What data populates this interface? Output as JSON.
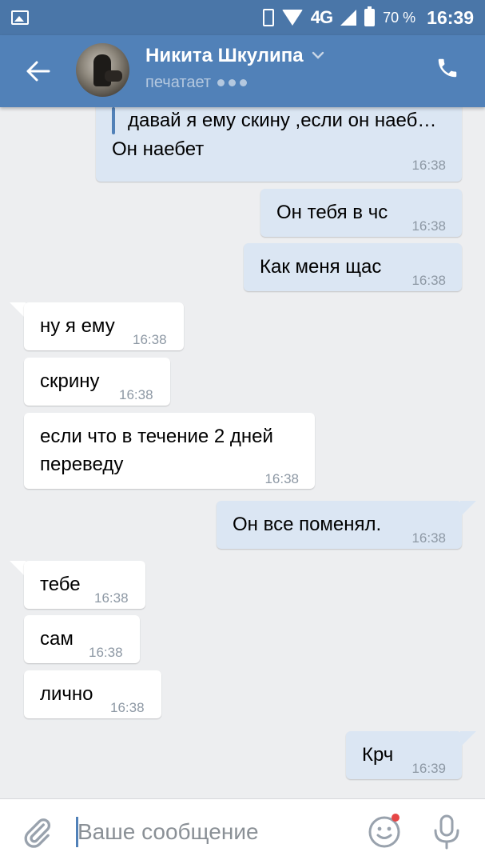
{
  "status_bar": {
    "network": "4G",
    "battery": "70 %",
    "time": "16:39"
  },
  "header": {
    "name": "Никита Шкулипа",
    "status": "печатает",
    "colors": {
      "header": "#5181b8",
      "status_bar": "#4a76a8"
    }
  },
  "messages": [
    {
      "side": "out",
      "quote": "давай я ему скину ,если он наеб…",
      "text": "Он наебет",
      "time": "16:38"
    },
    {
      "side": "out",
      "text": "Он тебя в чс",
      "time": "16:38"
    },
    {
      "side": "out",
      "text": "Как меня щас",
      "time": "16:38"
    },
    {
      "side": "in",
      "text": "ну я ему",
      "time": "16:38"
    },
    {
      "side": "in",
      "text": "скрину",
      "time": "16:38"
    },
    {
      "side": "in",
      "text": "если что в течение 2 дней",
      "text2": "переведу",
      "time": "16:38"
    },
    {
      "side": "out",
      "text": "Он все поменял.",
      "time": "16:38"
    },
    {
      "side": "in",
      "text": "тебе",
      "time": "16:38"
    },
    {
      "side": "in",
      "text": "сам",
      "time": "16:38"
    },
    {
      "side": "in",
      "text": "лично",
      "time": "16:38"
    },
    {
      "side": "out",
      "text": "Крч",
      "time": "16:39"
    }
  ],
  "input": {
    "placeholder": "Ваше сообщение"
  },
  "colors": {
    "outgoing_bubble": "#dbe6f3",
    "incoming_bubble": "#ffffff",
    "background": "#edeef0"
  }
}
